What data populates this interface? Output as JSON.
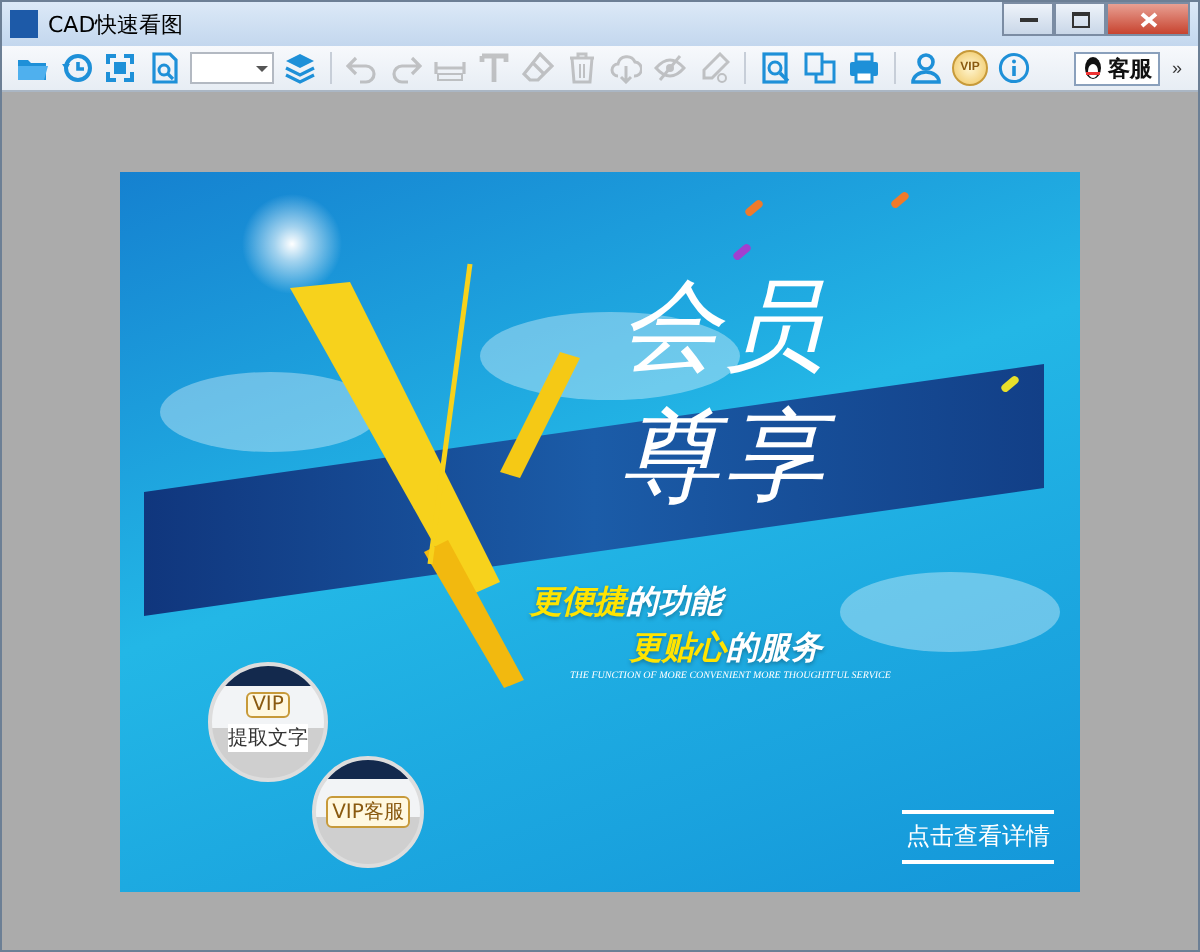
{
  "window": {
    "title": "CAD快速看图"
  },
  "toolbar": {
    "items": [
      {
        "kind": "button",
        "disabled": false
      },
      {
        "kind": "button",
        "disabled": false
      },
      {
        "kind": "button",
        "disabled": false
      },
      {
        "kind": "button",
        "disabled": false
      },
      {
        "kind": "dropdown",
        "disabled": false
      },
      {
        "kind": "button",
        "disabled": false
      },
      {
        "kind": "separator"
      },
      {
        "kind": "button",
        "disabled": true
      },
      {
        "kind": "button",
        "disabled": true
      },
      {
        "kind": "button",
        "disabled": true
      },
      {
        "kind": "button",
        "disabled": true
      },
      {
        "kind": "button",
        "disabled": true
      },
      {
        "kind": "button",
        "disabled": true
      },
      {
        "kind": "button",
        "disabled": true
      },
      {
        "kind": "button",
        "disabled": true
      },
      {
        "kind": "button",
        "disabled": true
      },
      {
        "kind": "separator"
      },
      {
        "kind": "button",
        "disabled": false
      },
      {
        "kind": "button",
        "disabled": false
      },
      {
        "kind": "button",
        "disabled": false
      },
      {
        "kind": "separator"
      },
      {
        "kind": "button",
        "disabled": false
      },
      {
        "kind": "badge",
        "label": "VIP",
        "disabled": false
      },
      {
        "kind": "button",
        "disabled": false
      }
    ],
    "service_button": {
      "label": "客服"
    },
    "overflow": "»"
  },
  "banner": {
    "headline": [
      "会员",
      "尊享"
    ],
    "slogans": [
      {
        "highlight": "更便捷",
        "rest": "的功能"
      },
      {
        "highlight": "更贴心",
        "rest": "的服务"
      }
    ],
    "tagline": "THE FUNCTION OF MORE CONVENIENT MORE THOUGHTFUL SERVICE",
    "insets": [
      {
        "badge": "VIP",
        "tooltip": "提取文字"
      },
      {
        "badge": "VIP客服"
      }
    ],
    "details_button": "点击查看详情"
  }
}
